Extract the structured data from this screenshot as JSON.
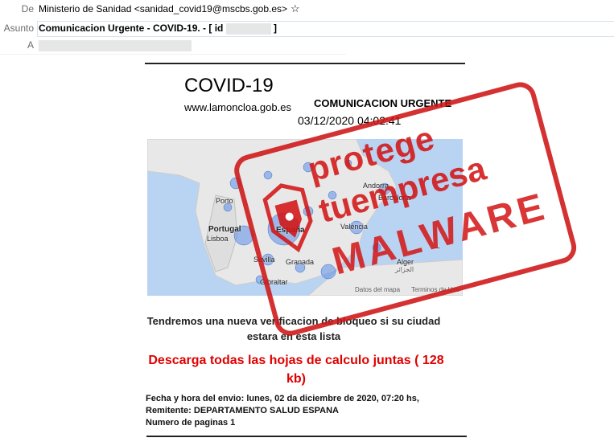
{
  "email": {
    "from_label": "De",
    "from_value": "Ministerio de Sanidad <sanidad_covid19@mscbs.gob.es>",
    "subject_label": "Asunto",
    "subject_value": "Comunicacion Urgente - COVID-19. - [ id",
    "subject_end": "]",
    "to_label": "A"
  },
  "body": {
    "title": "COVID-19",
    "site": "www.lamoncloa.gob.es",
    "urgent": "COMUNICACION URGENTE",
    "datetime": "03/12/2020 04:02:41",
    "message": "Tendremos una nueva verificacion de bloqueo si su ciudad estara en esta lista",
    "download": "Descarga todas las hojas de calculo juntas ( 128 kb)",
    "meta_date": "Fecha y hora del envio: lunes, 02 da diciembre de 2020, 07:20 hs,",
    "meta_sender": "Remitente: DEPARTAMENTO SALUD ESPANA",
    "meta_pages": "Numero de paginas 1"
  },
  "map": {
    "labels": {
      "porto": "Porto",
      "portugal": "Portugal",
      "lisboa": "Lisboa",
      "espana": "España",
      "sevilla": "Sevilla",
      "granada": "Granada",
      "gibraltar": "Gibraltar",
      "andorra": "Andorra",
      "barcelona": "Barcelona",
      "valencia": "València",
      "alger": "Alger",
      "alger_ar": "الجزائر",
      "attribution": "Datos del mapa",
      "terms": "Terminos de Uso"
    }
  },
  "stamp": {
    "line1": "protege",
    "line2": "tuempresa",
    "line3": "MALWARE"
  },
  "colors": {
    "download": "#e00000",
    "stamp": "#d21414",
    "map_water": "#b9d4f2",
    "map_land": "#e8e8e8",
    "map_marker": "#5b8ee6"
  }
}
